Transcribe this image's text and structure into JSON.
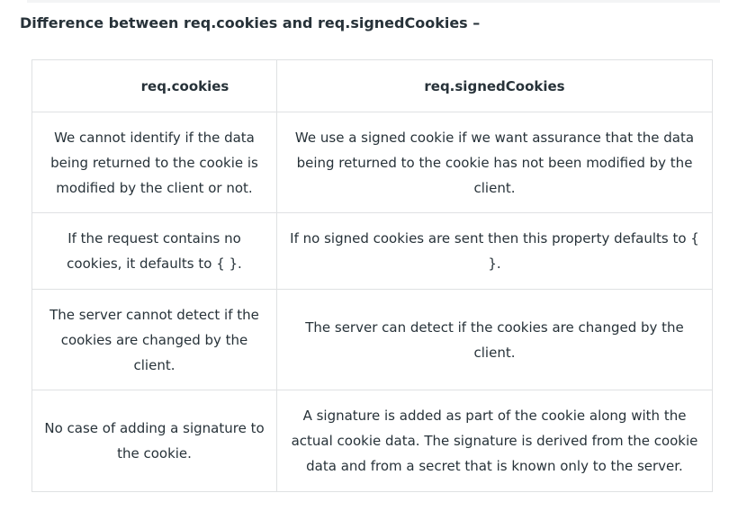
{
  "heading": "Difference between req.cookies and req.signedCookies –",
  "table": {
    "headers": [
      "req.cookies",
      "req.signedCookies"
    ],
    "rows": [
      [
        "We cannot identify if the data being returned to the cookie is modified by the client or not.",
        "We use a signed cookie if we want assurance that the data being returned to the cookie has not been modified by the client."
      ],
      [
        "If the request contains no cookies, it defaults to { }.",
        "If no signed cookies are sent then this property defaults to { }."
      ],
      [
        "The server cannot detect if the cookies are changed by the client.",
        "The server can detect if the cookies are changed by the client."
      ],
      [
        "No case of adding a signature to the cookie.",
        "A signature is added as part of the cookie along with the actual cookie data. The signature is derived from the cookie data and from a secret that is known only to the server."
      ]
    ]
  }
}
